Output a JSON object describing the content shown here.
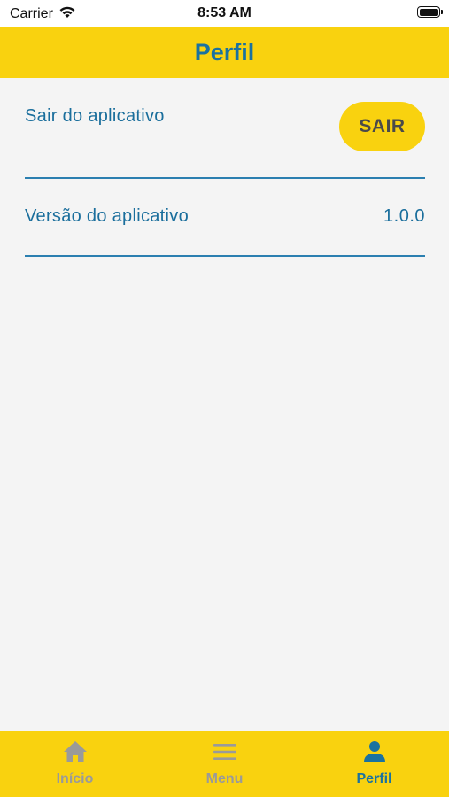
{
  "status_bar": {
    "carrier": "Carrier",
    "time": "8:53 AM",
    "icons": [
      "wifi-icon",
      "battery-icon"
    ]
  },
  "header": {
    "title": "Perfil"
  },
  "settings": {
    "logout": {
      "label": "Sair do aplicativo",
      "button_label": "SAIR"
    },
    "version": {
      "label": "Versão do aplicativo",
      "value": "1.0.0"
    }
  },
  "tab_bar": {
    "tabs": [
      {
        "label": "Início",
        "icon": "home-icon",
        "active": false
      },
      {
        "label": "Menu",
        "icon": "menu-icon",
        "active": false
      },
      {
        "label": "Perfil",
        "icon": "person-icon",
        "active": true
      }
    ]
  },
  "colors": {
    "brand_yellow": "#f9d20f",
    "brand_blue": "#1a72a0",
    "inactive_gray": "#9a9a9a",
    "background": "#f4f4f4"
  }
}
